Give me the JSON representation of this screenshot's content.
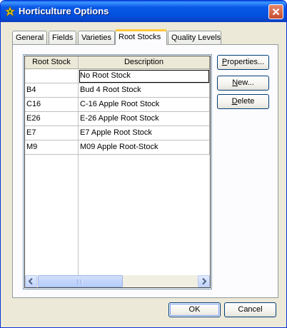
{
  "window": {
    "title": "Horticulture Options"
  },
  "tabs": [
    {
      "label": "General"
    },
    {
      "label": "Fields"
    },
    {
      "label": "Varieties"
    },
    {
      "label": "Root Stocks"
    },
    {
      "label": "Quality Levels"
    }
  ],
  "table": {
    "headers": [
      "Root Stock",
      "Description"
    ],
    "rows": [
      {
        "code": "",
        "description": "No Root Stock"
      },
      {
        "code": "B4",
        "description": "Bud 4 Root Stock"
      },
      {
        "code": "C16",
        "description": "C-16 Apple Root Stock"
      },
      {
        "code": "E26",
        "description": "E-26 Apple Root Stock"
      },
      {
        "code": "E7",
        "description": "E7 Apple Root Stock"
      },
      {
        "code": "M9",
        "description": "M09 Apple Root-Stock"
      }
    ]
  },
  "side_buttons": {
    "properties": {
      "first": "P",
      "rest": "roperties..."
    },
    "new": {
      "first": "N",
      "rest": "ew..."
    },
    "delete": {
      "first": "D",
      "rest": "elete"
    }
  },
  "footer": {
    "ok": "OK",
    "cancel": "Cancel"
  },
  "icons": {
    "app": "plant-icon",
    "close": "close-icon",
    "scroll_left": "arrow-left-icon",
    "scroll_right": "arrow-right-icon",
    "scroll_grip": "grip-icon"
  }
}
